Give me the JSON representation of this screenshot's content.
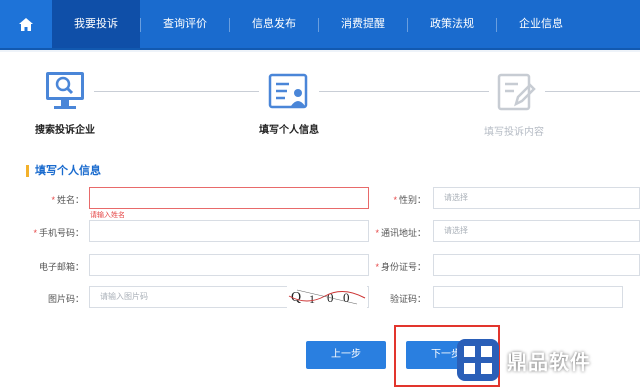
{
  "nav": {
    "items": [
      "我要投诉",
      "查询评价",
      "信息发布",
      "消费提醒",
      "政策法规",
      "企业信息"
    ],
    "active_index": 0
  },
  "steps": [
    {
      "label": "搜索投诉企业",
      "state": "done"
    },
    {
      "label": "填写个人信息",
      "state": "current"
    },
    {
      "label": "填写投诉内容",
      "state": "pending"
    }
  ],
  "section_title": "填写个人信息",
  "form": {
    "name": {
      "label": "姓名：",
      "required": true,
      "value": "",
      "error": "请输入姓名"
    },
    "gender": {
      "label": "性别：",
      "required": true,
      "placeholder": "请选择"
    },
    "phone": {
      "label": "手机号码：",
      "required": true,
      "value": ""
    },
    "address": {
      "label": "通讯地址：",
      "required": true,
      "placeholder": "请选择"
    },
    "email": {
      "label": "电子邮箱：",
      "required": false,
      "value": ""
    },
    "id_number": {
      "label": "身份证号：",
      "required": true,
      "value": ""
    },
    "image_code": {
      "label": "图片码：",
      "required": false,
      "placeholder": "请输入图片码"
    },
    "verify_code": {
      "label": "验证码：",
      "required": false,
      "value": ""
    }
  },
  "captcha_text": "Q 1 0 0",
  "buttons": {
    "prev": "上一步",
    "next": "下一步"
  },
  "watermark": "鼎品软件",
  "colors": {
    "nav": "#1a6bce",
    "active_nav": "#0f4fa8",
    "accent": "#2a7fe0",
    "error": "#e54545",
    "highlight_box": "#e2352d"
  }
}
